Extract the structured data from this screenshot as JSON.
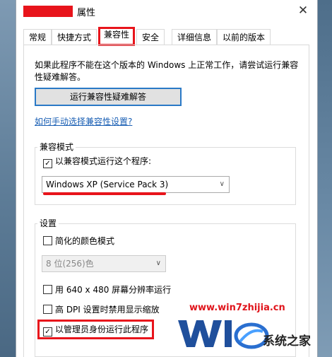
{
  "window": {
    "title": "属性",
    "close_glyph": "✕"
  },
  "tabs": [
    {
      "label": "常规",
      "selected": false
    },
    {
      "label": "快捷方式",
      "selected": false
    },
    {
      "label": "兼容性",
      "selected": true
    },
    {
      "label": "安全",
      "selected": false
    },
    {
      "label": "详细信息",
      "selected": false
    },
    {
      "label": "以前的版本",
      "selected": false
    }
  ],
  "compat": {
    "description": "如果此程序不能在这个版本的 Windows 上正常工作，请尝试运行兼容性疑难解答。",
    "troubleshoot_button": "运行兼容性疑难解答",
    "manual_link": "如何手动选择兼容性设置?"
  },
  "compat_mode": {
    "group_label": "兼容模式",
    "checkbox_label": "以兼容模式运行这个程序:",
    "checked": true,
    "selected_os": "Windows XP (Service Pack 3)"
  },
  "settings": {
    "group_label": "设置",
    "reduced_color": {
      "label": "简化的颜色模式",
      "checked": false
    },
    "color_select": "8 位(256)色",
    "res_640": {
      "label": "用 640 x 480 屏幕分辨率运行",
      "checked": false
    },
    "high_dpi": {
      "label": "高 DPI 设置时禁用显示缩放",
      "checked": false
    },
    "run_admin": {
      "label": "以管理员身份运行此程序",
      "checked": true
    }
  },
  "watermark": {
    "url": "www.win7zhijia.cn",
    "brand_text": "系统之家"
  },
  "colors": {
    "highlight_red": "#e8141b",
    "link_blue": "#1a5fb4",
    "focus_blue": "#2a79c6"
  }
}
